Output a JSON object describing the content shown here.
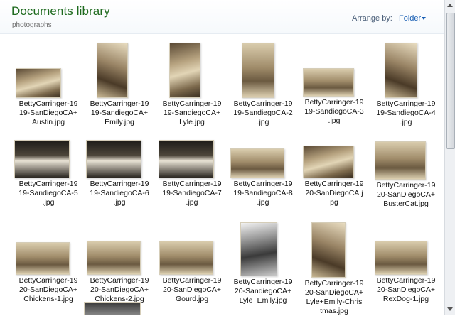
{
  "header": {
    "title": "Documents library",
    "subtitle": "photographs",
    "arrange_label": "Arrange by:",
    "arrange_value": "Folder"
  },
  "icons": {
    "arrange_dropdown": "chevron-down-icon",
    "scroll_up": "scroll-up-icon",
    "scroll_down": "scroll-down-icon"
  },
  "files": [
    {
      "caption": "BettyCarringer-19\n19-SanDiegoCA+\nAustin.jpg",
      "tone": "sepia1"
    },
    {
      "caption": "BettyCarringer-19\n19-SandiegoCA+\nEmily.jpg",
      "tone": "sepia2"
    },
    {
      "caption": "BettyCarringer-19\n19-SandiegoCA+\nLyle.jpg",
      "tone": "sepia1"
    },
    {
      "caption": "BettyCarringer-19\n19-SandiegoCA-2\n.jpg",
      "tone": "sepia3"
    },
    {
      "caption": "BettyCarringer-19\n19-SandiegoCA-3\n.jpg",
      "tone": "sepia3"
    },
    {
      "caption": "BettyCarringer-19\n19-SandiegoCA-4\n.jpg",
      "tone": "sepia2"
    },
    {
      "caption": "BettyCarringer-19\n19-SandiegoCA-5\n.jpg",
      "tone": "dark"
    },
    {
      "caption": "BettyCarringer-19\n19-SandiegoCA-6\n.jpg",
      "tone": "dark"
    },
    {
      "caption": "BettyCarringer-19\n19-SandiegoCA-7\n.jpg",
      "tone": "dark"
    },
    {
      "caption": "BettyCarringer-19\n19-SandiegoCA-8\n.jpg",
      "tone": "sepia3"
    },
    {
      "caption": "BettyCarringer-19\n20-SanDiegoCA.j\npg",
      "tone": "sepia1"
    },
    {
      "caption": "BettyCarringer-19\n20-SanDiegoCA+\nBusterCat.jpg",
      "tone": "sepia3"
    },
    {
      "caption": "BettyCarringer-19\n20-SanDiegoCA+\nChickens-1.jpg",
      "tone": "sepia3"
    },
    {
      "caption": "BettyCarringer-19\n20-SanDiegoCA+\nChickens-2.jpg",
      "tone": "sepia3"
    },
    {
      "caption": "BettyCarringer-19\n20-SanDiegoCA+\nGourd.jpg",
      "tone": "sepia3"
    },
    {
      "caption": "BettyCarringer-19\n20-SandiegoCA+\nLyle+Emily.jpg",
      "tone": "gray"
    },
    {
      "caption": "BettyCarringer-19\n20-SanDiegoCA+\nLyle+Emily-Chris\ntmas.jpg",
      "tone": "sepia2"
    },
    {
      "caption": "BettyCarringer-19\n20-SanDiegoCA+\nRexDog-1.jpg",
      "tone": "sepia3"
    }
  ]
}
